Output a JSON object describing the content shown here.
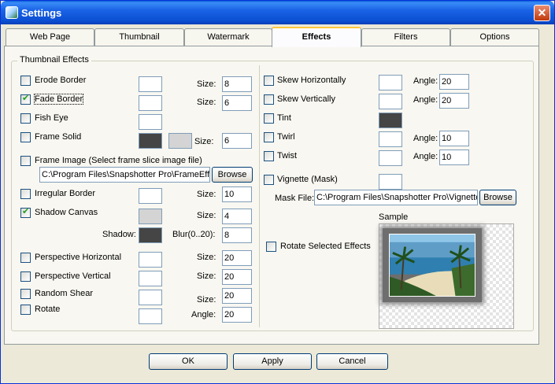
{
  "window": {
    "title": "Settings",
    "close_glyph": "✕"
  },
  "tabs": [
    "Web Page",
    "Thumbnail",
    "Watermark",
    "Effects",
    "Filters",
    "Options"
  ],
  "active_tab": "Effects",
  "group_label": "Thumbnail Effects",
  "left": {
    "erode": {
      "label": "Erode Border",
      "checked": false,
      "size_label": "Size:",
      "size": "8"
    },
    "fade": {
      "label": "Fade Border",
      "checked": true,
      "size_label": "Size:",
      "size": "6"
    },
    "fisheye": {
      "label": "Fish Eye",
      "checked": false
    },
    "frame_solid": {
      "label": "Frame Solid",
      "checked": false,
      "size_label": "Size:",
      "size": "6"
    },
    "frame_image": {
      "label": "Frame Image (Select frame slice image file)",
      "checked": false,
      "path": "C:\\Program Files\\Snapshotter Pro\\FrameEffe",
      "browse": "Browse"
    },
    "irregular": {
      "label": "Irregular Border",
      "checked": false,
      "size_label": "Size:",
      "size": "10"
    },
    "shadow": {
      "label": "Shadow Canvas",
      "checked": true,
      "size_label": "Size:",
      "size": "4",
      "shadow_label": "Shadow:",
      "blur_label": "Blur(0..20):",
      "blur": "8"
    },
    "persp_h": {
      "label": "Perspective Horizontal",
      "checked": false,
      "size_label": "Size:",
      "size": "20"
    },
    "persp_v": {
      "label": "Perspective Vertical",
      "checked": false,
      "size_label": "Size:",
      "size": "20"
    },
    "random_shear": {
      "label": "Random Shear",
      "checked": false,
      "size_label": "Size:",
      "size": "20"
    },
    "rotate": {
      "label": "Rotate",
      "checked": false,
      "angle_label": "Angle:",
      "angle": "20"
    }
  },
  "right": {
    "skew_h": {
      "label": "Skew Horizontally",
      "checked": false,
      "angle_label": "Angle:",
      "angle": "20"
    },
    "skew_v": {
      "label": "Skew Vertically",
      "checked": false,
      "angle_label": "Angle:",
      "angle": "20"
    },
    "tint": {
      "label": "Tint",
      "checked": false
    },
    "twirl": {
      "label": "Twirl",
      "checked": false,
      "angle_label": "Angle:",
      "angle": "10"
    },
    "twist": {
      "label": "Twist",
      "checked": false,
      "angle_label": "Angle:",
      "angle": "10"
    },
    "vignette": {
      "label": "Vignette (Mask)",
      "checked": false,
      "mask_label": "Mask File:",
      "mask_path": "C:\\Program Files\\Snapshotter Pro\\Vignette",
      "browse": "Browse"
    },
    "sample_label": "Sample",
    "rotate_selected": {
      "label": "Rotate Selected Effects",
      "checked": false
    }
  },
  "buttons": {
    "ok": "OK",
    "apply": "Apply",
    "cancel": "Cancel"
  },
  "colors": {
    "title_bar": "#0a5fd8",
    "dark_swatch": "#454545",
    "light_swatch": "#d4d4d4",
    "active_tab_highlight": "#ffc83c"
  }
}
